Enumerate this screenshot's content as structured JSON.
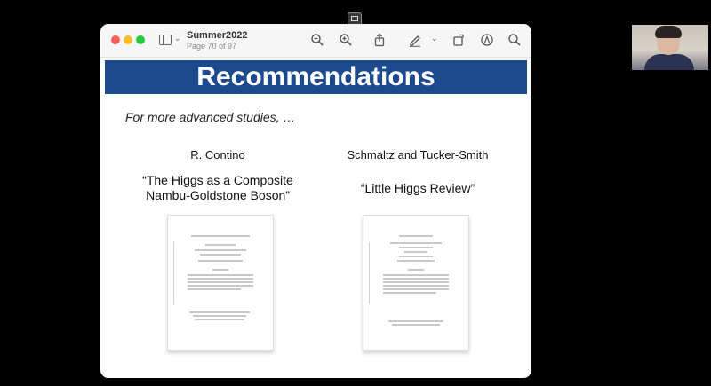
{
  "window": {
    "title": "Summer2022",
    "page_info": "Page 70 of 97"
  },
  "toolbar": {
    "icons": [
      "sidebar-icon",
      "zoom-out-icon",
      "zoom-in-icon",
      "share-icon",
      "markup-pen-icon",
      "rotate-icon",
      "markup-icon",
      "search-icon"
    ]
  },
  "slide": {
    "heading": "Recommendations",
    "subheading": "For more advanced studies, …",
    "left": {
      "author": "R. Contino",
      "title": "“The Higgs as a Composite Nambu-Goldstone Boson”"
    },
    "right": {
      "author": "Schmaltz and Tucker-Smith",
      "title": "“Little Higgs Review”"
    }
  },
  "colors": {
    "banner": "#1c4a8f",
    "background": "#000000"
  }
}
